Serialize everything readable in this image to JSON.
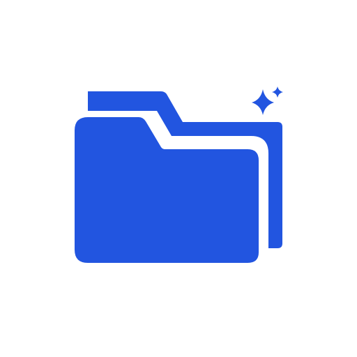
{
  "icon": {
    "name": "folder-with-sparkle-icon",
    "primary_color": "#2255E0",
    "background_color": "#FFFFFF"
  }
}
